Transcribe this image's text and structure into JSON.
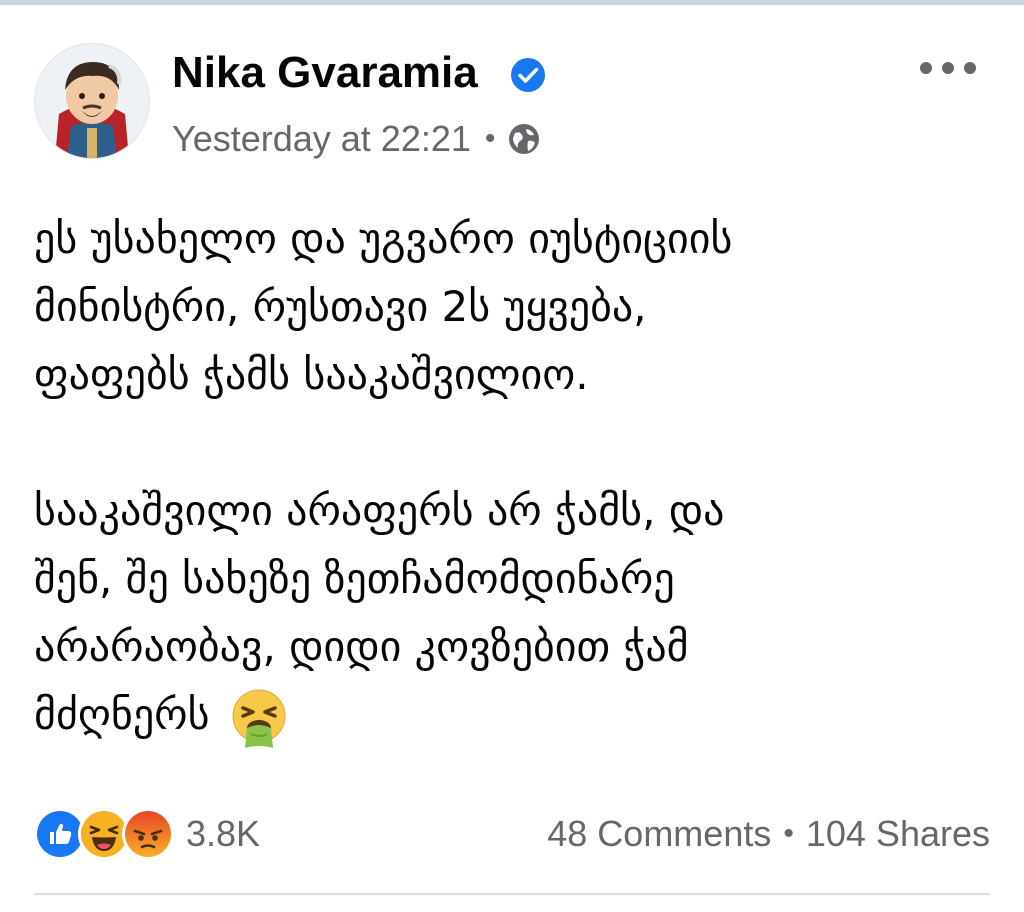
{
  "post": {
    "author": "Nika Gvaramia",
    "timestamp": "Yesterday at 22:21",
    "meta_separator": "•",
    "audience_icon": "globe-icon",
    "verified_icon": "verified-badge-icon",
    "more_icon": "more-options-icon",
    "paragraphs": [
      "ეს უსახელო და უგვარო იუსტიციის\nმინისტრი, რუსთავი 2ს უყვება,\nფაფებს ჭამს სააკაშვილიო.",
      "სააკაშვილი არაფერს არ ჭამს, და\nშენ, შე სახეზე ზეთჩამომდინარე\nარარაობავ, დიდი კოვზებით ჭამ\nმძღნერს"
    ],
    "trailing_emoji": "face-vomiting-emoji"
  },
  "footer": {
    "reaction_icons": [
      "like-icon",
      "haha-icon",
      "angry-icon"
    ],
    "reaction_count": "3.8K",
    "comments": "48 Comments",
    "stats_separator": "•",
    "shares": "104 Shares"
  },
  "colors": {
    "brand_blue": "#1877f2",
    "muted_text": "#65676b",
    "body_text": "#050505",
    "divider": "#dadde1"
  }
}
